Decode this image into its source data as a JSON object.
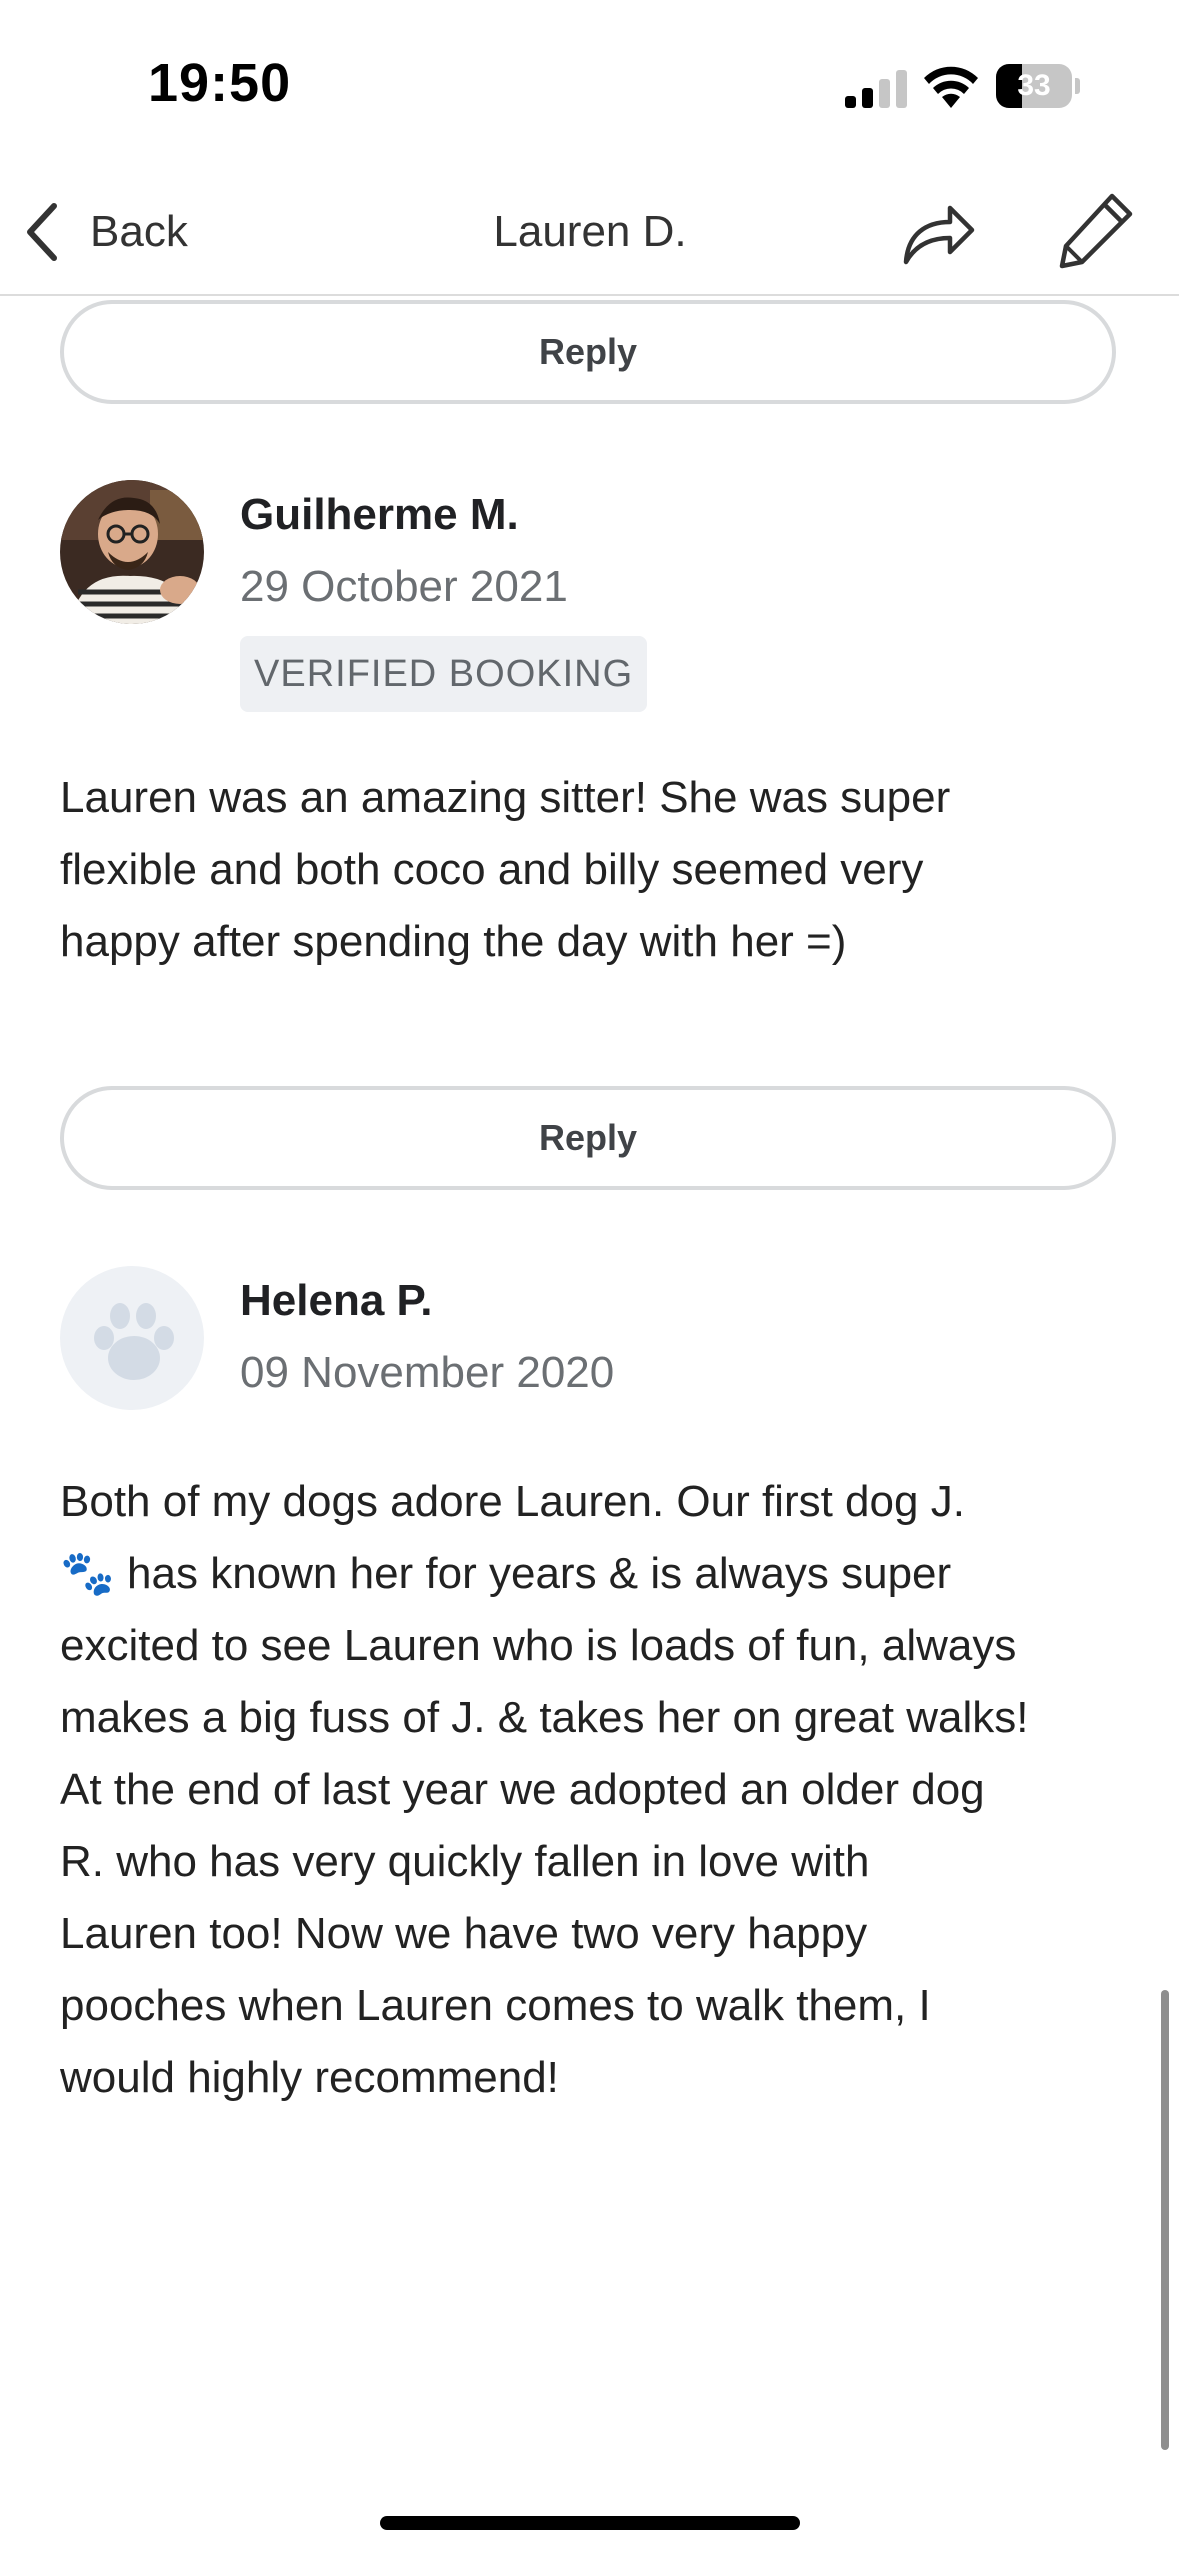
{
  "status_bar": {
    "time": "19:50",
    "battery_level": "33",
    "signal_icon": "cellular-signal-icon",
    "wifi_icon": "wifi-icon"
  },
  "nav": {
    "back_label": "Back",
    "title": "Lauren D.",
    "share_icon": "share-icon",
    "edit_icon": "pencil-icon"
  },
  "reviews": [
    {
      "reply_label": "Reply"
    },
    {
      "name": "Guilherme M.",
      "date": "29 October 2021",
      "badge": "VERIFIED BOOKING",
      "text": "Lauren was an amazing sitter! She was super\nflexible and both coco and billy seemed very\nhappy after spending the day with her =)",
      "reply_label": "Reply"
    },
    {
      "name": "Helena P.",
      "date": "09 November 2020",
      "text_line1": "Both of my dogs adore Lauren.  Our first dog J.",
      "emoji": "🐾",
      "text_rest": " has known her for years & is always super\nexcited to see Lauren who is loads of fun, always\nmakes a big fuss of J. & takes her on great walks!\nAt the end of last year we adopted an older dog\nR. who has very quickly fallen in love with\nLauren too!  Now we have two very happy\npooches when Lauren comes to walk them, I\nwould highly recommend!"
    }
  ],
  "colors": {
    "reply_border": "#d8dadc",
    "badge_bg": "#eef0f3",
    "date_text": "#6b6f73"
  }
}
